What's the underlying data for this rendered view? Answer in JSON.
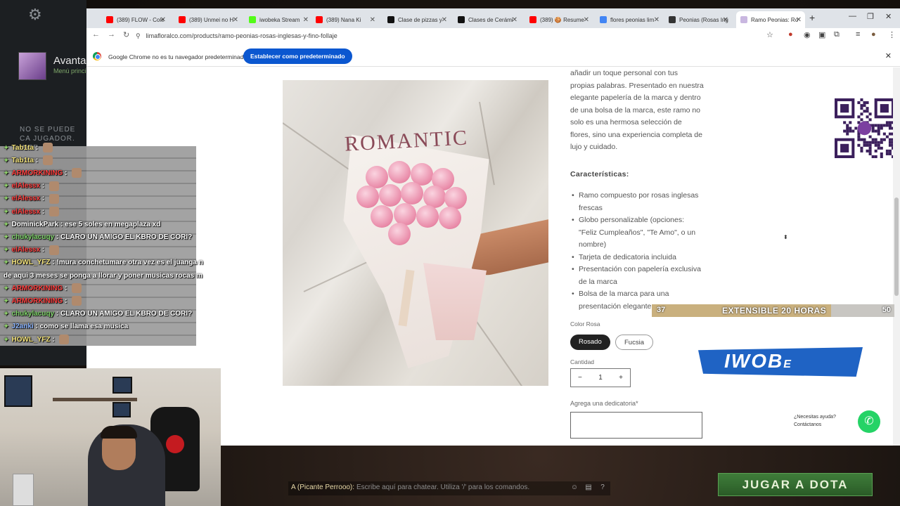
{
  "dota": {
    "profile_name": "Avanta",
    "profile_sub": "Menú princi",
    "cant_text": "NO SE PUEDE CA JUGADOR. INTE",
    "play_button": "JUGAR A DOTA",
    "chat_prefix": "A (Picante Perrooo):",
    "chat_placeholder": "Escribe aquí para chatear. Utiliza '/' para los comandos."
  },
  "browser": {
    "tabs": [
      {
        "label": "(389) FLOW - Cole",
        "color": "#ff0000"
      },
      {
        "label": "(389) Unmei no H",
        "color": "#ff0000"
      },
      {
        "label": "iwobeka Stream",
        "color": "#53fc18"
      },
      {
        "label": "(389) Nana Ki",
        "color": "#ff0000"
      },
      {
        "label": "Clase de pizzas y",
        "color": "#111111"
      },
      {
        "label": "Clases de Cerámi",
        "color": "#111111"
      },
      {
        "label": "(389) 🍪 Resume",
        "color": "#ff0000"
      },
      {
        "label": "flores peonias lim",
        "color": "#4285f4"
      },
      {
        "label": "Peonias (Rosas Ing",
        "color": "#333333"
      },
      {
        "label": "Ramo Peonias: Ro",
        "color": "#c9b7e0"
      }
    ],
    "url": "limafloralco.com/products/ramo-peonias-rosas-inglesas-y-fino-follaje",
    "infobar_text": "Google Chrome no es tu navegador predeterminado",
    "infobar_button": "Establecer como predeterminado"
  },
  "product": {
    "image_text": "ROMANTIC",
    "description": "añadir un toque personal con tus propias palabras. Presentado en nuestra elegante papelería de la marca y dentro de una bolsa de la marca, este ramo no solo es una hermosa selección de flores, sino una experiencia completa de lujo y cuidado.",
    "features_title": "Características:",
    "features": [
      "Ramo compuesto por rosas inglesas frescas",
      "Globo personalizable (opciones: \"Feliz Cumpleaños\", \"Te Amo\", o un nombre)",
      "Tarjeta de dedicatoria incluida",
      "Presentación con papelería exclusiva de la marca",
      "Bolsa de la marca para una presentación elegante"
    ],
    "color_label": "Color Rosa",
    "color_options": [
      "Rosado",
      "Fucsia"
    ],
    "color_selected": "Rosado",
    "quantity_label": "Cantidad",
    "quantity": "1",
    "minus": "−",
    "plus": "+",
    "dedication_label": "Agrega una dedicatoria*",
    "whatsapp_line1": "¿Necesitas ayuda?",
    "whatsapp_line2": "Contáctanos"
  },
  "stream": {
    "bar_left": "37",
    "bar_center": "EXTENSIBLE 20 HORAS",
    "bar_right": "50",
    "bar_progress": 0.74,
    "logo_text": "IWOB",
    "logo_suffix": "E"
  },
  "chat": [
    {
      "user": "Tab1ta",
      "color": "#f2e27a",
      "text": ""
    },
    {
      "user": "Tab1ta",
      "color": "#f2e27a",
      "text": ""
    },
    {
      "user": "ARMORKINING",
      "color": "#ff4040",
      "text": ""
    },
    {
      "user": "elAlessx",
      "color": "#ff4040",
      "text": ""
    },
    {
      "user": "elAlessx",
      "color": "#ff4040",
      "text": ""
    },
    {
      "user": "elAlessx",
      "color": "#ff4040",
      "text": ""
    },
    {
      "user": "DominickPark",
      "color": "#ffffff",
      "text": "ese 5 soles en megaplaza xd"
    },
    {
      "user": "chukylacuqy",
      "color": "#7fd36a",
      "text": "CLARO UN AMIGO EL KBRO DE CORI?"
    },
    {
      "user": "elAlessx",
      "color": "#ff4040",
      "text": ""
    },
    {
      "user": "HOWL_YFZ",
      "color": "#f2e27a",
      "text": "!mura conchetumare otra vez es el juanga n"
    },
    {
      "user": "",
      "color": "#ffffff",
      "text": "de aqui 3 meses se ponga a llorar y poner musicas rocas m"
    },
    {
      "user": "ARMORKINING",
      "color": "#ff4040",
      "text": ""
    },
    {
      "user": "ARMORKINING",
      "color": "#ff4040",
      "text": ""
    },
    {
      "user": "chukylacuqy",
      "color": "#7fd36a",
      "text": "CLARO UN AMIGO EL KBRO DE CORI?"
    },
    {
      "user": "J2anki",
      "color": "#8ab4ff",
      "text": "como se llama esa musica"
    },
    {
      "user": "HOWL_YFZ",
      "color": "#f2e27a",
      "text": ""
    }
  ]
}
